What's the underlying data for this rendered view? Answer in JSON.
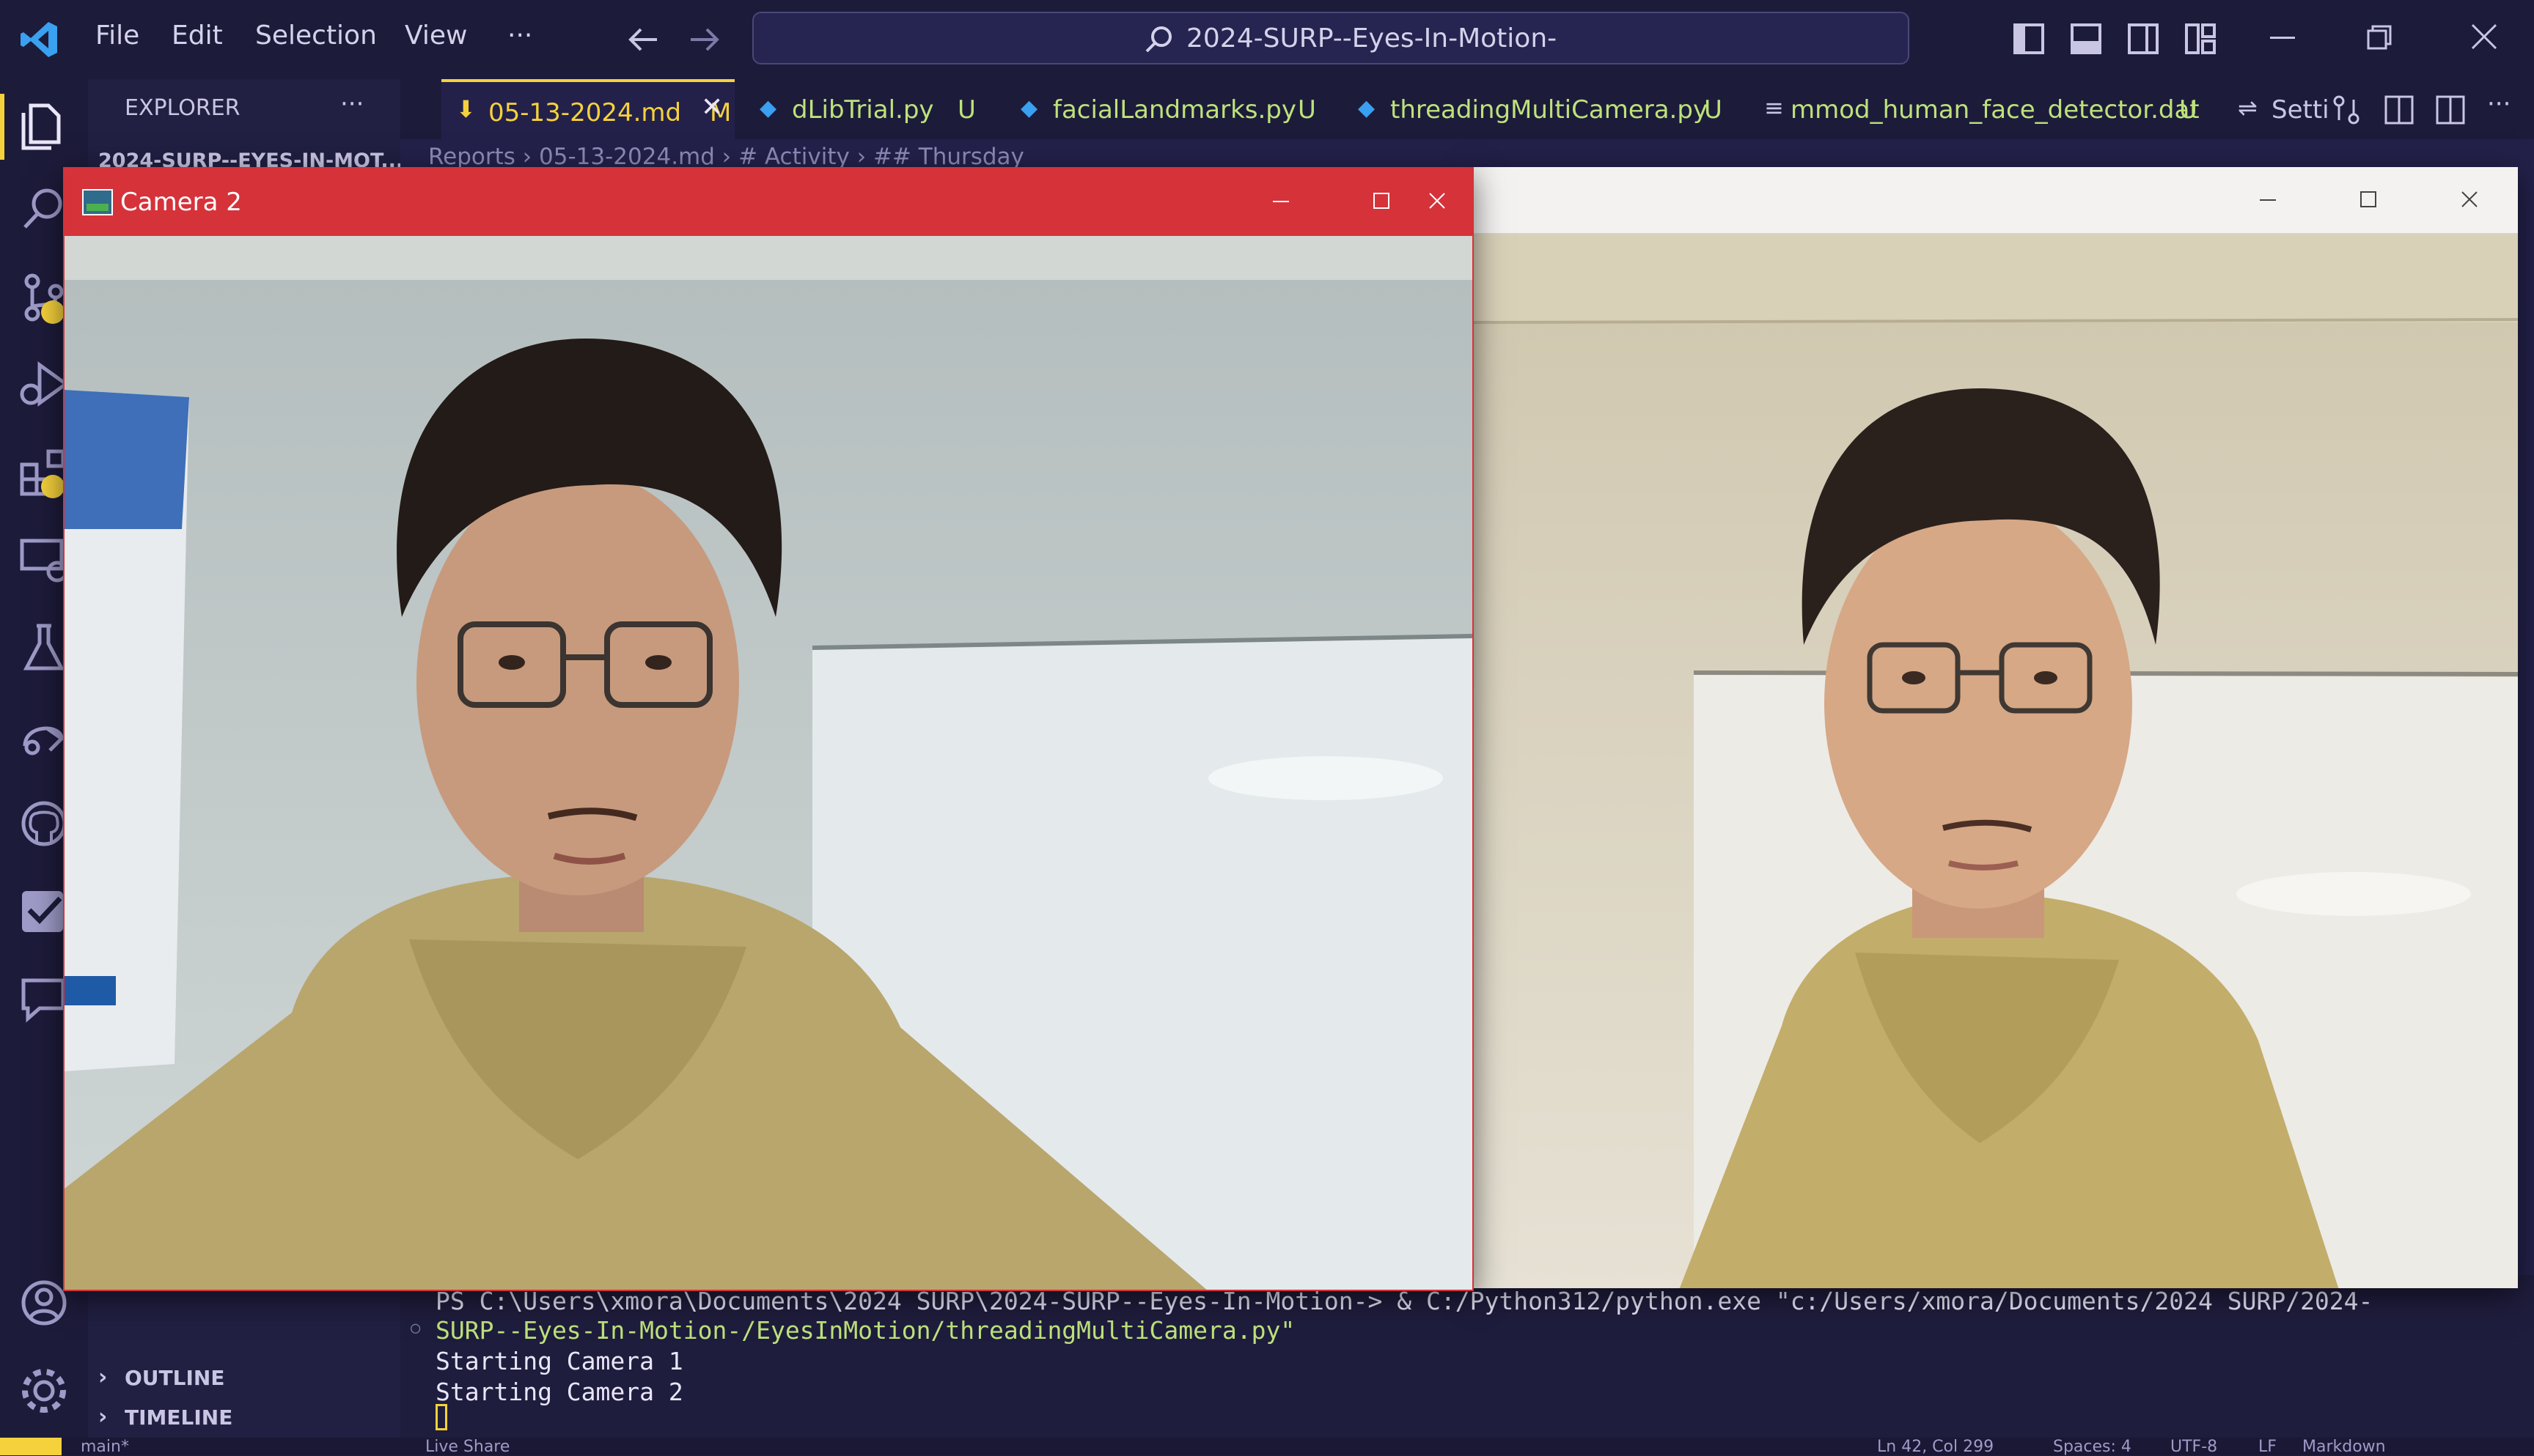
{
  "menu": [
    "File",
    "Edit",
    "Selection",
    "View",
    "···"
  ],
  "command_center": {
    "text": "2024-SURP--Eyes-In-Motion-"
  },
  "sidebar": {
    "title": "EXPLORER",
    "more": "···",
    "root": "2024-SURP--EYES-IN-MOT...",
    "sections": [
      "OUTLINE",
      "TIMELINE"
    ]
  },
  "tabs": [
    {
      "label": "05-13-2024.md",
      "status": "M",
      "active": true
    },
    {
      "label": "dLibTrial.py",
      "status": "U"
    },
    {
      "label": "facialLandmarks.py",
      "status": "U"
    },
    {
      "label": "threadingMultiCamera.py",
      "status": "U"
    },
    {
      "label": "mmod_human_face_detector.dat",
      "status": "U"
    },
    {
      "label": "Setti",
      "status": ""
    }
  ],
  "breadcrumb": [
    "Reports",
    "05-13-2024.md",
    "# Activity",
    "## Thursday"
  ],
  "terminal": {
    "lines": [
      "PS C:\\Users\\xmora\\Documents\\2024 SURP\\2024-SURP--Eyes-In-Motion-> & C:/Python312/python.exe \"c:/Users/xmora/Documents/2024 SURP/2024-",
      "SURP--Eyes-In-Motion-/EyesInMotion/threadingMultiCamera.py\"",
      "Starting Camera 1",
      "Starting Camera 2"
    ]
  },
  "windows": {
    "camera2": {
      "title": "Camera 2"
    }
  },
  "statusbar": {
    "branch": "main*",
    "liveshare": "Live Share",
    "position": "Ln 42, Col 299",
    "spaces": "Spaces: 4",
    "encoding": "UTF-8",
    "eol": "LF",
    "language": "Markdown"
  },
  "colors": {
    "camera2_titlebar": "#d6323a",
    "accent": "#f5d13c",
    "tab_text": "#bde27b"
  }
}
